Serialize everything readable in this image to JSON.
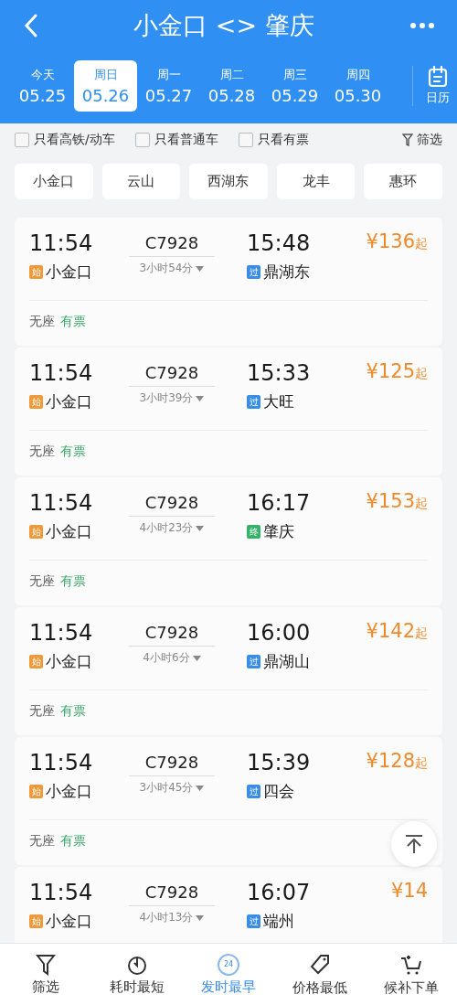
{
  "header": {
    "title": "小金口 <> 肇庆"
  },
  "dates": [
    {
      "weekday": "今天",
      "date": "05.25",
      "selected": false
    },
    {
      "weekday": "周日",
      "date": "05.26",
      "selected": true
    },
    {
      "weekday": "周一",
      "date": "05.27",
      "selected": false
    },
    {
      "weekday": "周二",
      "date": "05.28",
      "selected": false
    },
    {
      "weekday": "周三",
      "date": "05.29",
      "selected": false
    },
    {
      "weekday": "周四",
      "date": "05.30",
      "selected": false
    }
  ],
  "calendar": {
    "label": "日历"
  },
  "filters": [
    {
      "label": "只看高铁/动车",
      "checked": false
    },
    {
      "label": "只看普通车",
      "checked": false
    },
    {
      "label": "只看有票",
      "checked": false
    }
  ],
  "filter_button": "筛选",
  "stations": [
    "小金口",
    "云山",
    "西湖东",
    "龙丰",
    "惠环"
  ],
  "trains": [
    {
      "depart": "11:54",
      "number": "C7928",
      "arrive": "15:48",
      "price": "¥136",
      "price_suffix": "起",
      "from": {
        "kind": "start",
        "badge": "始",
        "name": "小金口"
      },
      "duration": "3小时54分",
      "to": {
        "kind": "pass",
        "badge": "过",
        "name": "鼎湖东"
      },
      "seat": "无座",
      "availability": "有票"
    },
    {
      "depart": "11:54",
      "number": "C7928",
      "arrive": "15:33",
      "price": "¥125",
      "price_suffix": "起",
      "from": {
        "kind": "start",
        "badge": "始",
        "name": "小金口"
      },
      "duration": "3小时39分",
      "to": {
        "kind": "pass",
        "badge": "过",
        "name": "大旺"
      },
      "seat": "无座",
      "availability": "有票"
    },
    {
      "depart": "11:54",
      "number": "C7928",
      "arrive": "16:17",
      "price": "¥153",
      "price_suffix": "起",
      "from": {
        "kind": "start",
        "badge": "始",
        "name": "小金口"
      },
      "duration": "4小时23分",
      "to": {
        "kind": "end",
        "badge": "终",
        "name": "肇庆"
      },
      "seat": "无座",
      "availability": "有票"
    },
    {
      "depart": "11:54",
      "number": "C7928",
      "arrive": "16:00",
      "price": "¥142",
      "price_suffix": "起",
      "from": {
        "kind": "start",
        "badge": "始",
        "name": "小金口"
      },
      "duration": "4小时6分",
      "to": {
        "kind": "pass",
        "badge": "过",
        "name": "鼎湖山"
      },
      "seat": "无座",
      "availability": "有票"
    },
    {
      "depart": "11:54",
      "number": "C7928",
      "arrive": "15:39",
      "price": "¥128",
      "price_suffix": "起",
      "from": {
        "kind": "start",
        "badge": "始",
        "name": "小金口"
      },
      "duration": "3小时45分",
      "to": {
        "kind": "pass",
        "badge": "过",
        "name": "四会"
      },
      "seat": "无座",
      "availability": "有票"
    },
    {
      "depart": "11:54",
      "number": "C7928",
      "arrive": "16:07",
      "price": "¥14",
      "from": {
        "kind": "start",
        "badge": "始",
        "name": "小金口"
      },
      "duration": "4小时13分",
      "to": {
        "kind": "pass",
        "badge": "过",
        "name": "端州"
      }
    }
  ],
  "bottom_nav": [
    {
      "kind": "filter",
      "label": "筛选",
      "selected": false
    },
    {
      "kind": "timer",
      "label": "耗时最短",
      "selected": false
    },
    {
      "kind": "clock24",
      "label": "发时最早",
      "icon_text": "24",
      "selected": true
    },
    {
      "kind": "tag",
      "label": "价格最低",
      "selected": false
    },
    {
      "kind": "cart",
      "label": "候补下单",
      "selected": false
    }
  ]
}
